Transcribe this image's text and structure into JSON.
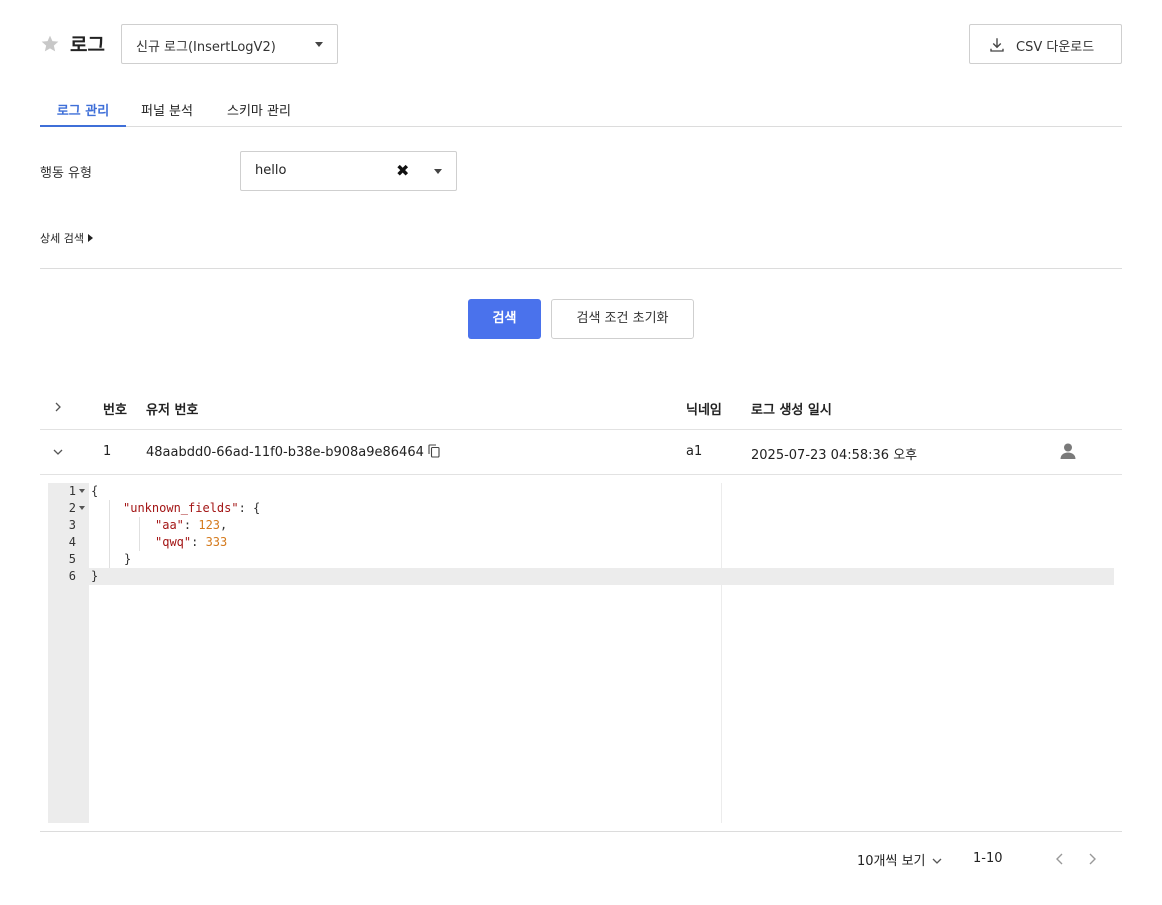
{
  "header": {
    "title": "로그",
    "log_select_value": "신규 로그(InsertLogV2)",
    "csv_button": "CSV 다운로드"
  },
  "tabs": [
    {
      "label": "로그 관리",
      "active": true
    },
    {
      "label": "퍼널 분석",
      "active": false
    },
    {
      "label": "스키마 관리",
      "active": false
    }
  ],
  "filter": {
    "label": "행동 유형",
    "value": "hello",
    "advanced_search": "상세 검색"
  },
  "actions": {
    "search": "검색",
    "reset": "검색 조건 초기화"
  },
  "table": {
    "columns": [
      "번호",
      "유저 번호",
      "닉네임",
      "로그 생성 일시"
    ],
    "rows": [
      {
        "no": "1",
        "user_id": "48aabdd0-66ad-11f0-b38e-b908a9e86464",
        "nickname": "a1",
        "created_at": "2025-07-23 04:58:36 오후"
      }
    ]
  },
  "editor": {
    "line_numbers": [
      "1",
      "2",
      "3",
      "4",
      "5",
      "6"
    ],
    "lines": {
      "l1": "{",
      "l2_key": "\"unknown_fields\"",
      "l2_rest": ": {",
      "l3_key": "\"aa\"",
      "l3_sep": ": ",
      "l3_val": "123",
      "l3_end": ",",
      "l4_key": "\"qwq\"",
      "l4_sep": ": ",
      "l4_val": "333",
      "l5": "}",
      "l6": "}"
    }
  },
  "pagination": {
    "per_page": "10개씩 보기",
    "range": "1-10"
  },
  "colors": {
    "accent": "#4a72ec",
    "tab_active": "#3f6fd8",
    "json_key": "#a31515",
    "json_number": "#d47a1d"
  }
}
